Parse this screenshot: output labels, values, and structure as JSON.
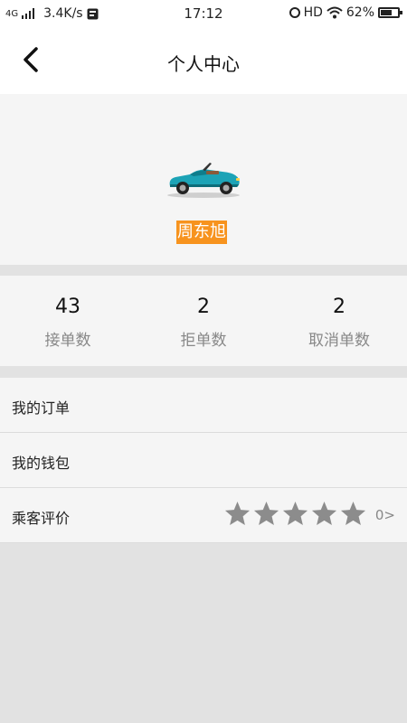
{
  "status_bar": {
    "network": "4G",
    "speed": "3.4K/s",
    "time": "17:12",
    "hd": "HD",
    "battery": "62%"
  },
  "header": {
    "title": "个人中心",
    "back_icon": "back-arrow-icon"
  },
  "profile": {
    "avatar_icon": "car-icon",
    "name": "周东旭"
  },
  "stats": [
    {
      "value": "43",
      "label": "接单数"
    },
    {
      "value": "2",
      "label": "拒单数"
    },
    {
      "value": "2",
      "label": "取消单数"
    }
  ],
  "menu": {
    "orders": "我的订单",
    "wallet": "我的钱包",
    "rating": "乘客评价",
    "rating_stars": 5,
    "rating_more": "0>"
  },
  "colors": {
    "accent": "#f7931e",
    "background": "#e2e2e2",
    "card": "#f5f5f5",
    "star": "#8c8c8c"
  }
}
